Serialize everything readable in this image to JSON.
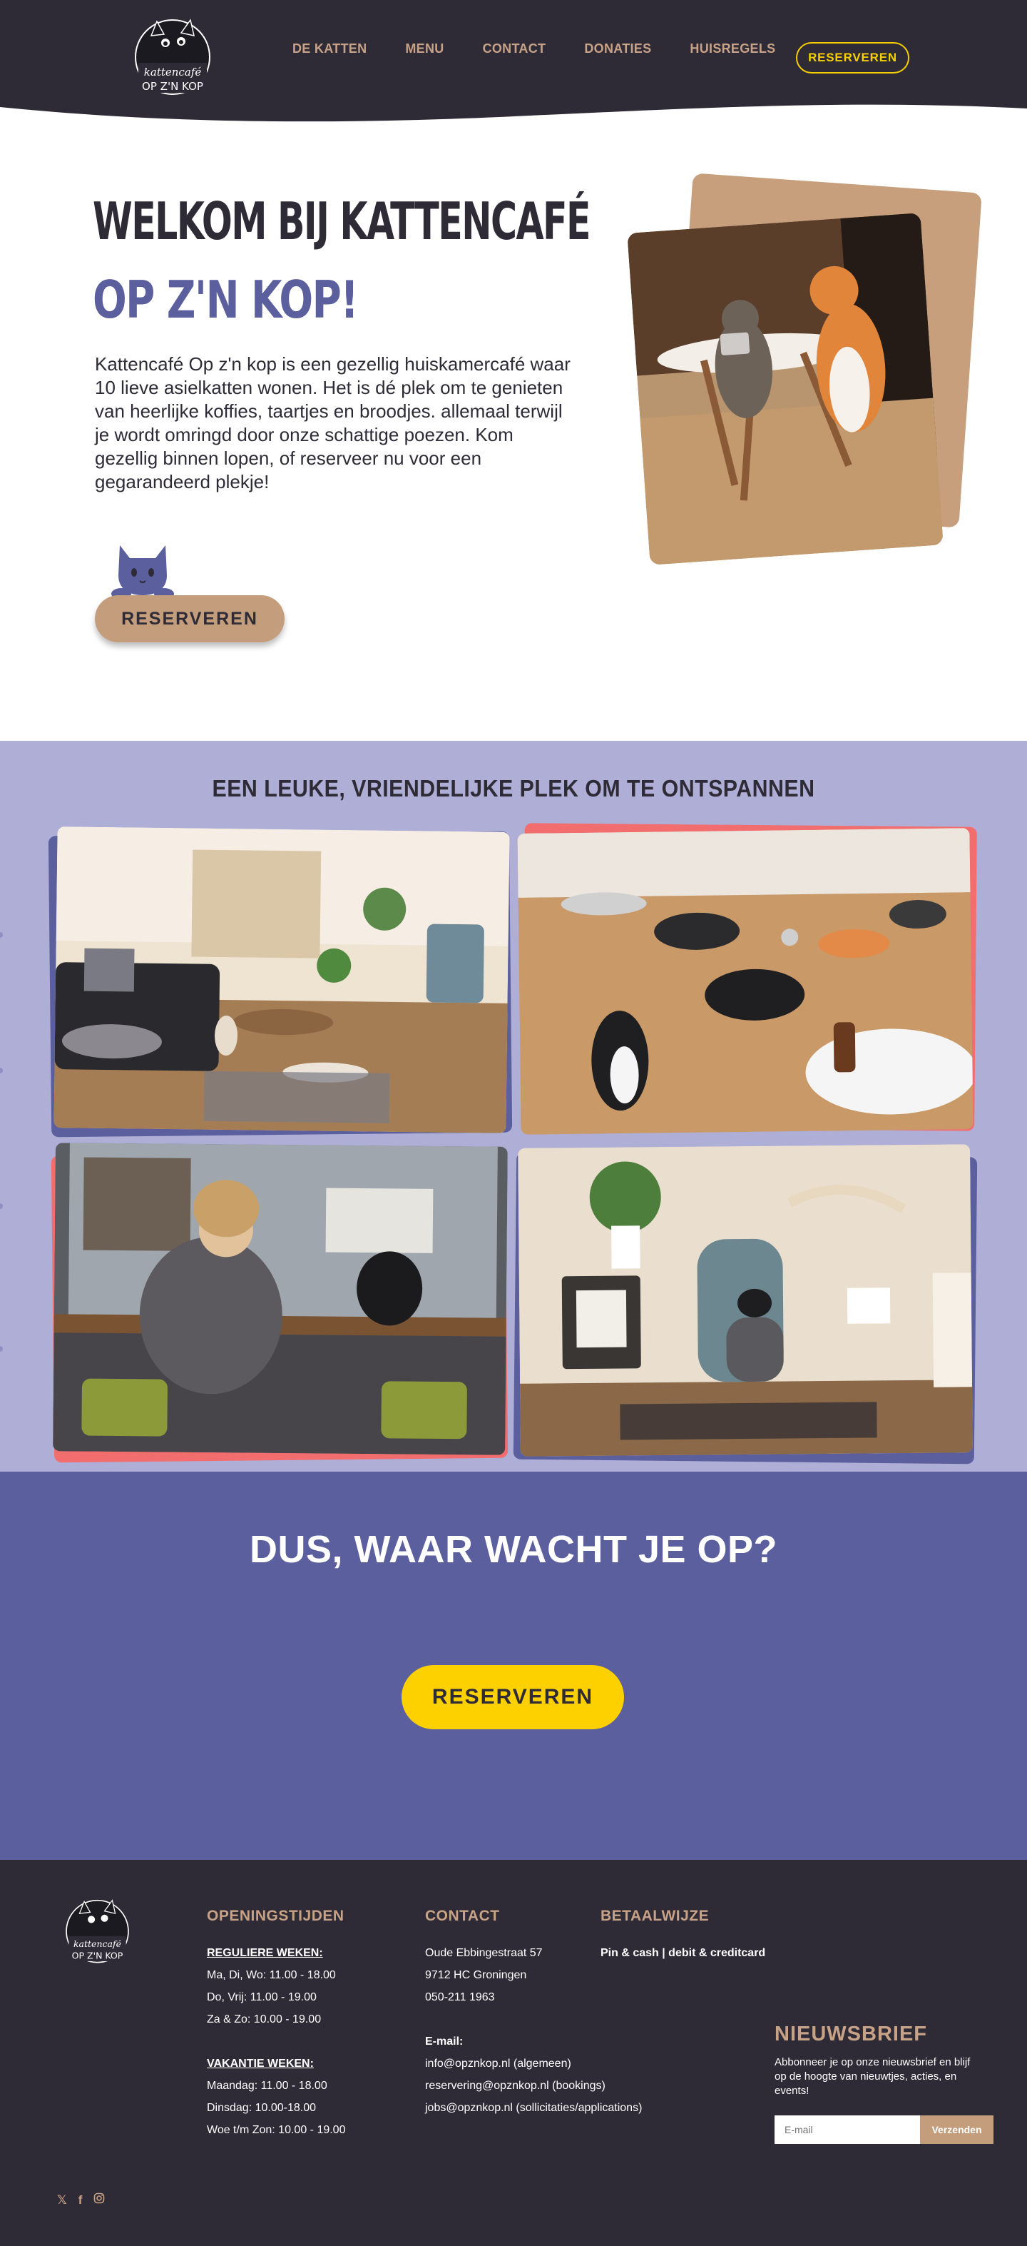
{
  "header": {
    "logo_text": [
      "kattencafé",
      "OP Z'N KOP"
    ],
    "nav": [
      "DE KATTEN",
      "MENU",
      "CONTACT",
      "DONATIES",
      "HUISREGELS"
    ],
    "reserve_label": "RESERVEREN"
  },
  "hero": {
    "title_line1": "WELKOM BIJ KATTENCAFÉ",
    "title_line2": "OP Z'N KOP!",
    "text": "Kattencafé Op z'n kop is een gezellig huiskamercafé waar 10 lieve asielkatten wonen. Het is dé plek om te genieten van heerlijke koffies, taartjes en broodjes. allemaal terwijl je wordt omringd door onze schattige poezen. Kom gezellig binnen lopen, of reserveer nu voor een gegarandeerd plekje!",
    "button": "RESERVEREN"
  },
  "gallery": {
    "title": "EEN LEUKE, VRIENDELIJKE PLEK OM TE ONTSPANNEN",
    "photo_alts": [
      "cafe interior with sofa",
      "cats eating on wooden floor",
      "woman at window with black cat",
      "cat on scratching post near tv"
    ]
  },
  "cta": {
    "title": "DUS, WAAR WACHT JE OP?",
    "button": "RESERVEREN"
  },
  "footer": {
    "logo_text": [
      "kattencafé",
      "OP Z'N KOP"
    ],
    "hours": {
      "heading": "OPENINGSTIJDEN",
      "regular_label": "REGULIERE WEKEN:",
      "regular": [
        "Ma, Di, Wo: 11.00 - 18.00",
        "Do, Vrij: 11.00 - 19.00",
        "Za & Zo: 10.00 - 19.00"
      ],
      "holiday_label": "VAKANTIE WEKEN:",
      "holiday": [
        "Maandag: 11.00 - 18.00",
        "Dinsdag: 10.00-18.00",
        "Woe t/m Zon: 10.00 - 19.00"
      ]
    },
    "contact": {
      "heading": "CONTACT",
      "address": [
        "Oude Ebbingestraat 57",
        "9712 HC Groningen",
        "050-211 1963"
      ],
      "email_label": "E-mail:",
      "emails": [
        "info@opznkop.nl (algemeen)",
        "reservering@opznkop.nl (bookings)",
        "jobs@opznkop.nl (sollicitaties/applications)"
      ]
    },
    "payment": {
      "heading": "BETAALWIJZE",
      "text": "Pin & cash | debit & creditcard"
    },
    "newsletter": {
      "heading": "NIEUWSBRIEF",
      "text": "Abbonneer je op onze nieuwsbrief en blijf op de hoogte van nieuwtjes, acties, en events!",
      "placeholder": "E-mail",
      "button": "Verzenden"
    },
    "socials": [
      "x-icon",
      "facebook-icon",
      "instagram-icon"
    ]
  },
  "colors": {
    "dark": "#2e2b37",
    "tan": "#c8a286",
    "purple": "#5b5f9e",
    "lavender": "#aeaed6",
    "yellow": "#fdd000",
    "coral": "#f07070"
  }
}
